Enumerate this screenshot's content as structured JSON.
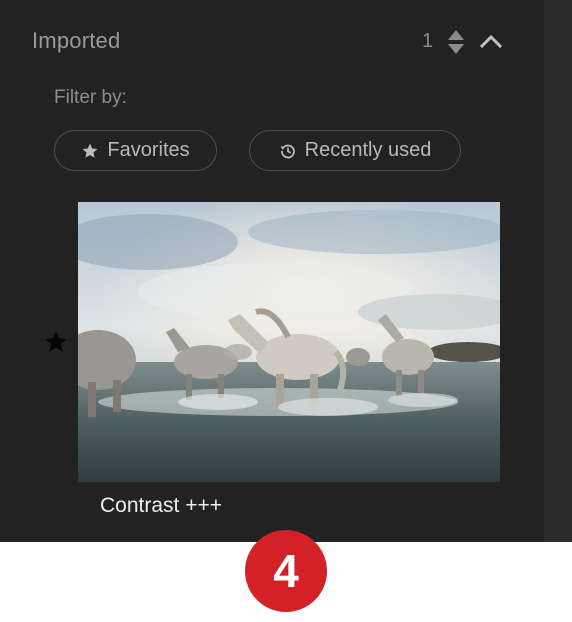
{
  "section": {
    "title": "Imported",
    "count": "1",
    "sort_icon": "sort-updown-icon",
    "collapse_icon": "chevron-up-icon"
  },
  "filter": {
    "label": "Filter by:",
    "chips": [
      {
        "label": "Favorites",
        "icon": "star-icon"
      },
      {
        "label": "Recently used",
        "icon": "history-icon"
      }
    ]
  },
  "presets": [
    {
      "name": "Contrast +++",
      "favorite": true,
      "thumbnail": "horses running through water"
    }
  ],
  "badge": {
    "number": "4",
    "color": "#d42027"
  },
  "colors": {
    "panel_bg": "#222222",
    "accent": "#d42027"
  }
}
